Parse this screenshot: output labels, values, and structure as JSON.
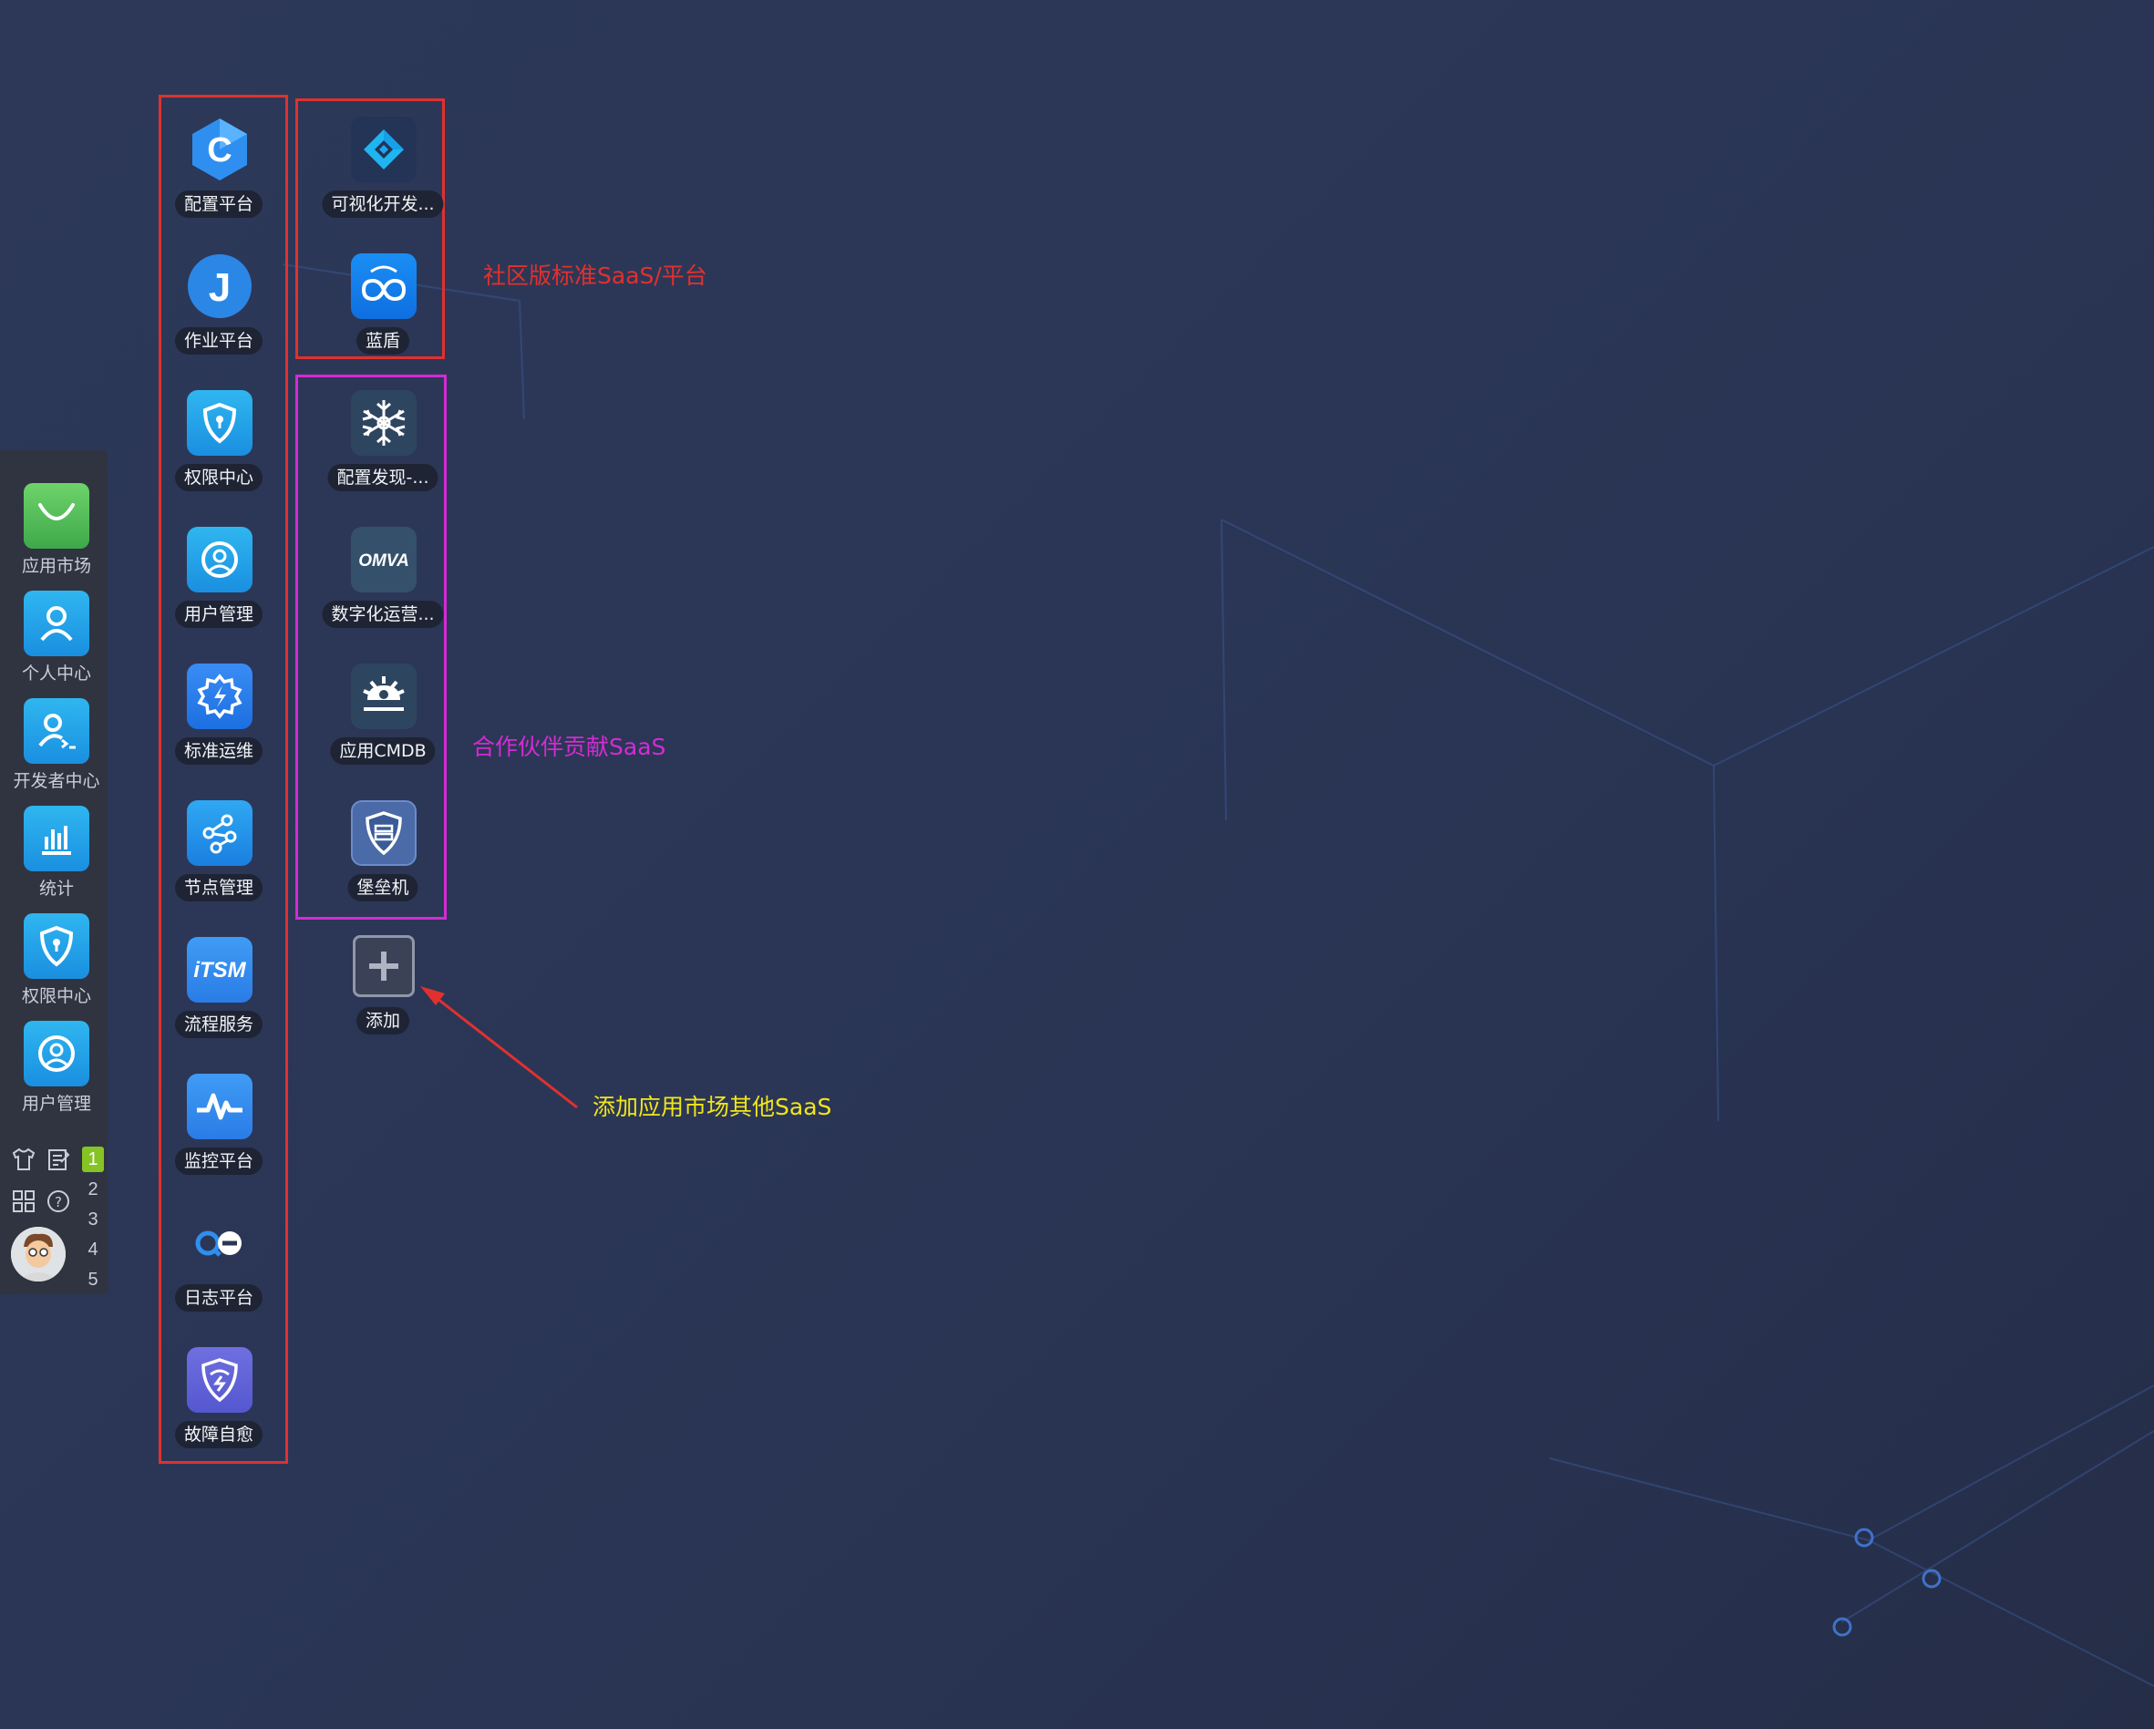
{
  "sidebar": {
    "items": [
      {
        "label": "应用市场",
        "icon": "shopping-bag-icon"
      },
      {
        "label": "个人中心",
        "icon": "person-icon"
      },
      {
        "label": "开发者中心",
        "icon": "developer-icon"
      },
      {
        "label": "统计",
        "icon": "bar-chart-icon"
      },
      {
        "label": "权限中心",
        "icon": "shield-icon"
      },
      {
        "label": "用户管理",
        "icon": "user-circle-icon"
      }
    ],
    "tools": [
      "shirt-icon",
      "notes-icon",
      "grid-icon",
      "help-icon"
    ],
    "desktops": [
      "1",
      "2",
      "3",
      "4",
      "5"
    ],
    "active_desktop": "1"
  },
  "column1": {
    "apps": [
      {
        "label": "配置平台",
        "icon": "cmdb-c-icon"
      },
      {
        "label": "作业平台",
        "icon": "job-j-icon"
      },
      {
        "label": "权限中心",
        "icon": "shield-icon"
      },
      {
        "label": "用户管理",
        "icon": "user-circle-icon"
      },
      {
        "label": "标准运维",
        "icon": "sops-gear-icon"
      },
      {
        "label": "节点管理",
        "icon": "nodes-icon"
      },
      {
        "label": "流程服务",
        "icon": "itsm-icon"
      },
      {
        "label": "监控平台",
        "icon": "monitor-pulse-icon"
      },
      {
        "label": "日志平台",
        "icon": "log-icon"
      },
      {
        "label": "故障自愈",
        "icon": "fault-heal-icon"
      }
    ]
  },
  "column2": {
    "community_apps": [
      {
        "label": "可视化开发...",
        "icon": "diamond-icon"
      },
      {
        "label": "蓝盾",
        "icon": "bkci-infinity-icon"
      }
    ],
    "partner_apps": [
      {
        "label": "配置发现-...",
        "icon": "snowflake-icon"
      },
      {
        "label": "数字化运营...",
        "icon": "omva-icon"
      },
      {
        "label": "应用CMDB",
        "icon": "cmdb-hub-icon"
      },
      {
        "label": "堡垒机",
        "icon": "bastion-shield-icon"
      }
    ],
    "add": {
      "label": "添加",
      "icon": "plus-icon"
    }
  },
  "annotations": {
    "community": "社区版标准SaaS/平台",
    "partner": "合作伙伴贡献SaaS",
    "add_hint": "添加应用市场其他SaaS"
  },
  "colors": {
    "red_frame": "#e0312e",
    "magenta_frame": "#d42bd4",
    "yellow_text": "#f2e616",
    "active_desktop": "#86c325"
  }
}
